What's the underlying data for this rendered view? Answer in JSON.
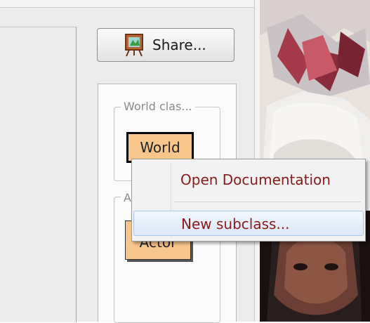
{
  "toolbar": {
    "share_label": "Share...",
    "share_icon": "easel-icon"
  },
  "class_browser": {
    "world_group_title": "World clas...",
    "world_class": "World",
    "actor_group_title": "A",
    "actor_class": "Actor"
  },
  "context_menu": {
    "items": [
      {
        "label": "Open Documentation",
        "highlighted": false
      },
      {
        "label": "New subclass...",
        "highlighted": true
      }
    ]
  },
  "colors": {
    "class_fill": "#f7c68c",
    "menu_text": "#8b1a1a",
    "menu_highlight": "#dbe8f7"
  }
}
